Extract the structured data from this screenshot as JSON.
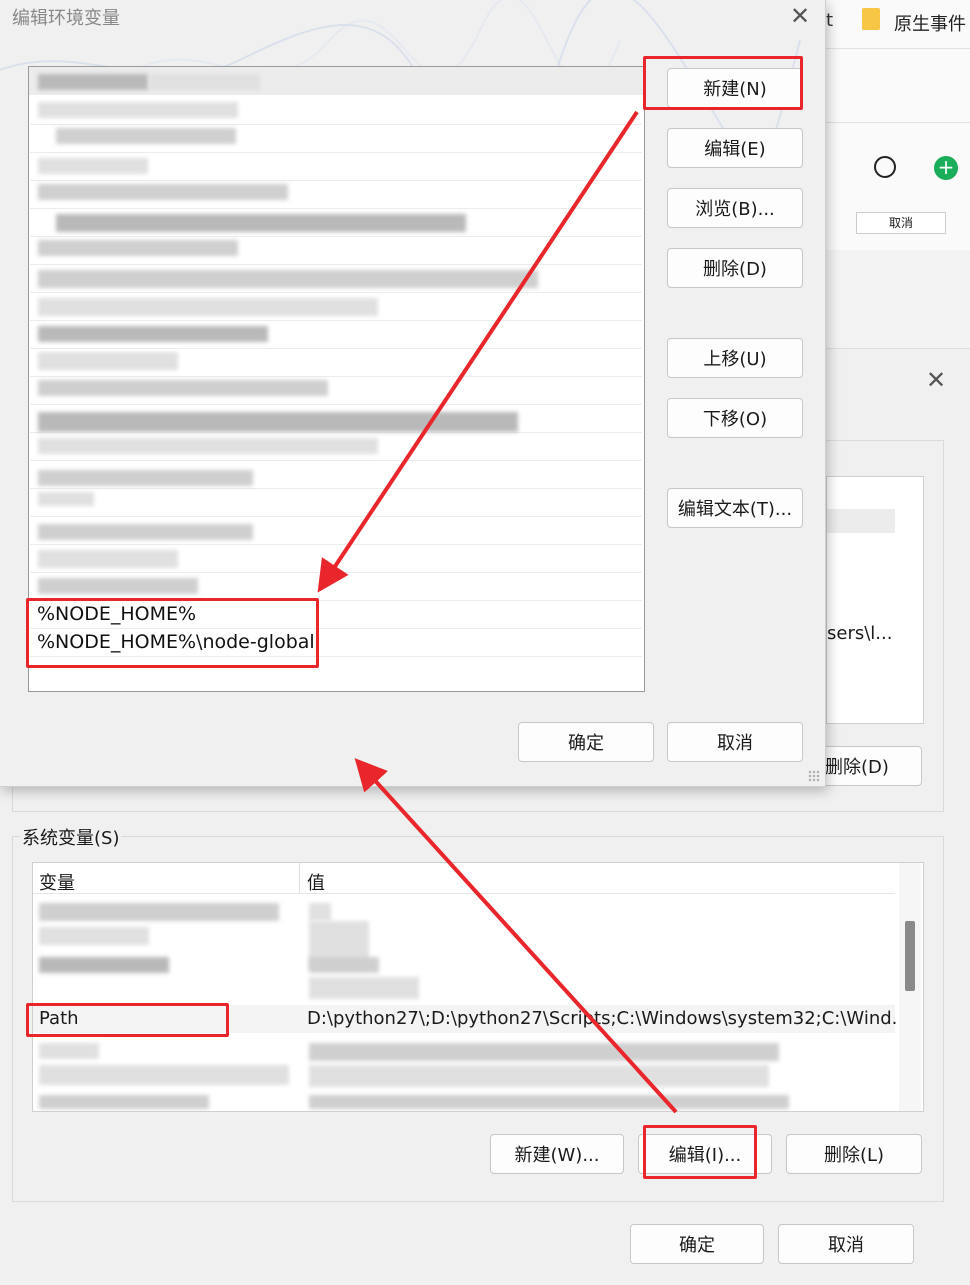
{
  "background_app": {
    "item_1": "t",
    "file_label": "原生事件",
    "cancel_small": "取消"
  },
  "env_vars_dialog": {
    "section_title": "系统变量(S)",
    "columns": [
      "变量",
      "值"
    ],
    "path_row": {
      "name": "Path",
      "value": "D:\\python27\\;D:\\python27\\Scripts;C:\\Windows\\system32;C:\\Wind..."
    },
    "partial_text": "sers\\l...",
    "user_delete_label": "删除(D)",
    "new_label": "新建(W)...",
    "edit_label": "编辑(I)...",
    "delete_label": "删除(L)",
    "ok_label": "确定",
    "cancel_label": "取消"
  },
  "edit_env_dialog": {
    "title": "编辑环境变量",
    "entries": [
      "%NODE_HOME%",
      "%NODE_HOME%\\node-global"
    ],
    "buttons": {
      "new": "新建(N)",
      "edit": "编辑(E)",
      "browse": "浏览(B)...",
      "delete": "删除(D)",
      "move_up": "上移(U)",
      "move_down": "下移(O)",
      "edit_text": "编辑文本(T)..."
    },
    "ok_label": "确定",
    "cancel_label": "取消"
  },
  "colors": {
    "annotation_red": "#e8262b",
    "dialog_bg": "#f0f0f0",
    "list_bg": "#ffffff"
  }
}
